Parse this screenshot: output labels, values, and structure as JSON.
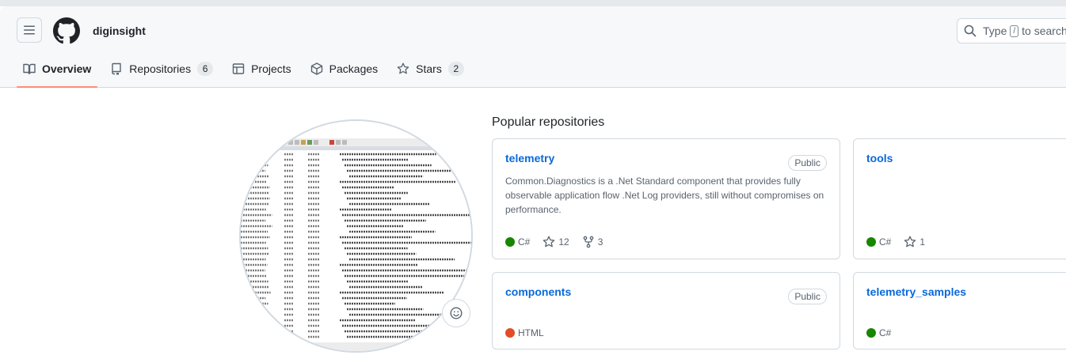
{
  "header": {
    "org_name": "diginsight",
    "search": {
      "prefix": "Type",
      "key": "/",
      "suffix": "to search"
    }
  },
  "tabs": [
    {
      "label": "Overview",
      "icon": "book-icon"
    },
    {
      "label": "Repositories",
      "icon": "repo-icon",
      "count": "6"
    },
    {
      "label": "Projects",
      "icon": "table-icon"
    },
    {
      "label": "Packages",
      "icon": "package-icon"
    },
    {
      "label": "Stars",
      "icon": "star-icon",
      "count": "2"
    }
  ],
  "popular": {
    "title": "Popular repositories",
    "repos": [
      {
        "name": "telemetry",
        "visibility": "Public",
        "description": "Common.Diagnostics is a .Net Standard component that provides fully observable application flow .Net Log providers, still without compromises on performance.",
        "language": "C#",
        "language_color": "#178600",
        "stars": "12",
        "forks": "3"
      },
      {
        "name": "tools",
        "visibility": "",
        "language": "C#",
        "language_color": "#178600",
        "stars": "1"
      },
      {
        "name": "components",
        "visibility": "Public",
        "language": "HTML",
        "language_color": "#e34c26"
      },
      {
        "name": "telemetry_samples",
        "visibility": "",
        "language": "C#",
        "language_color": "#178600"
      }
    ]
  },
  "colors": {
    "accent": "#0969da",
    "tab_underline": "#fd8c73"
  }
}
